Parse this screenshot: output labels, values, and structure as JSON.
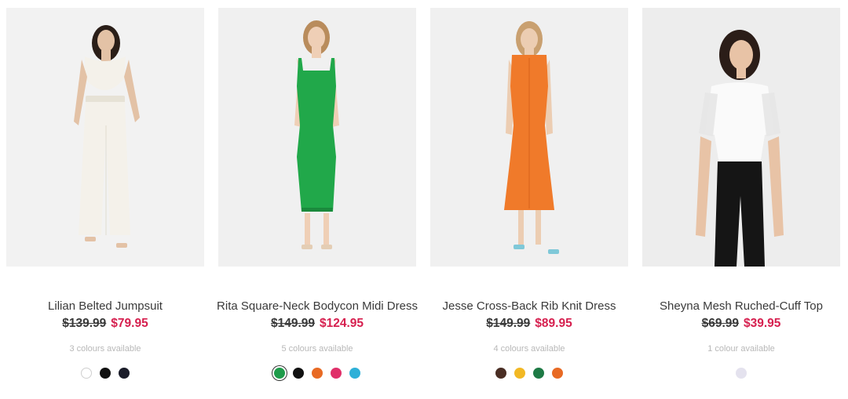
{
  "products": [
    {
      "name": "Lilian Belted Jumpsuit",
      "was_price": "$139.99",
      "now_price": "$79.95",
      "colours": "3 colours available",
      "swatches": [
        "white",
        "black",
        "navy"
      ],
      "colors": {
        "bg": "#f2f2f2",
        "garment": "#f4f1ea",
        "accent": "#e6e2d6"
      }
    },
    {
      "name": "Rita Square-Neck Bodycon Midi Dress",
      "was_price": "$149.99",
      "now_price": "$124.95",
      "colours": "5 colours available",
      "swatches": [
        "green",
        "black",
        "orange",
        "pink",
        "blue"
      ],
      "colors": {
        "bg": "#f0f0f0",
        "garment": "#21a84a",
        "accent": "#1a8a3c"
      }
    },
    {
      "name": "Jesse Cross-Back Rib Knit Dress",
      "was_price": "$149.99",
      "now_price": "$89.95",
      "colours": "4 colours available",
      "swatches": [
        "brown",
        "yellow",
        "green",
        "orange"
      ],
      "colors": {
        "bg": "#f0f0f0",
        "garment": "#f07a2a",
        "accent": "#d9621b"
      }
    },
    {
      "name": "Sheyna Mesh Ruched-Cuff Top",
      "was_price": "$69.99",
      "now_price": "$39.95",
      "colours": "1 colour available",
      "swatches": [
        "lilac"
      ],
      "colors": {
        "bg": "#ededed",
        "garment": "#fafafa",
        "accent": "#151515"
      }
    }
  ],
  "palette": {
    "price_sale": "#d6204f",
    "swatch_white": "#ffffff",
    "swatch_black": "#111111",
    "swatch_navy": "#1b1d2a",
    "swatch_green": "#1e9b4a",
    "swatch_orange": "#e86a24",
    "swatch_pink": "#e0306a",
    "swatch_blue": "#2fb0d8",
    "swatch_brown": "#4a2e24",
    "swatch_yellow": "#f2b824",
    "swatch_lilac": "#e4e2ee"
  }
}
